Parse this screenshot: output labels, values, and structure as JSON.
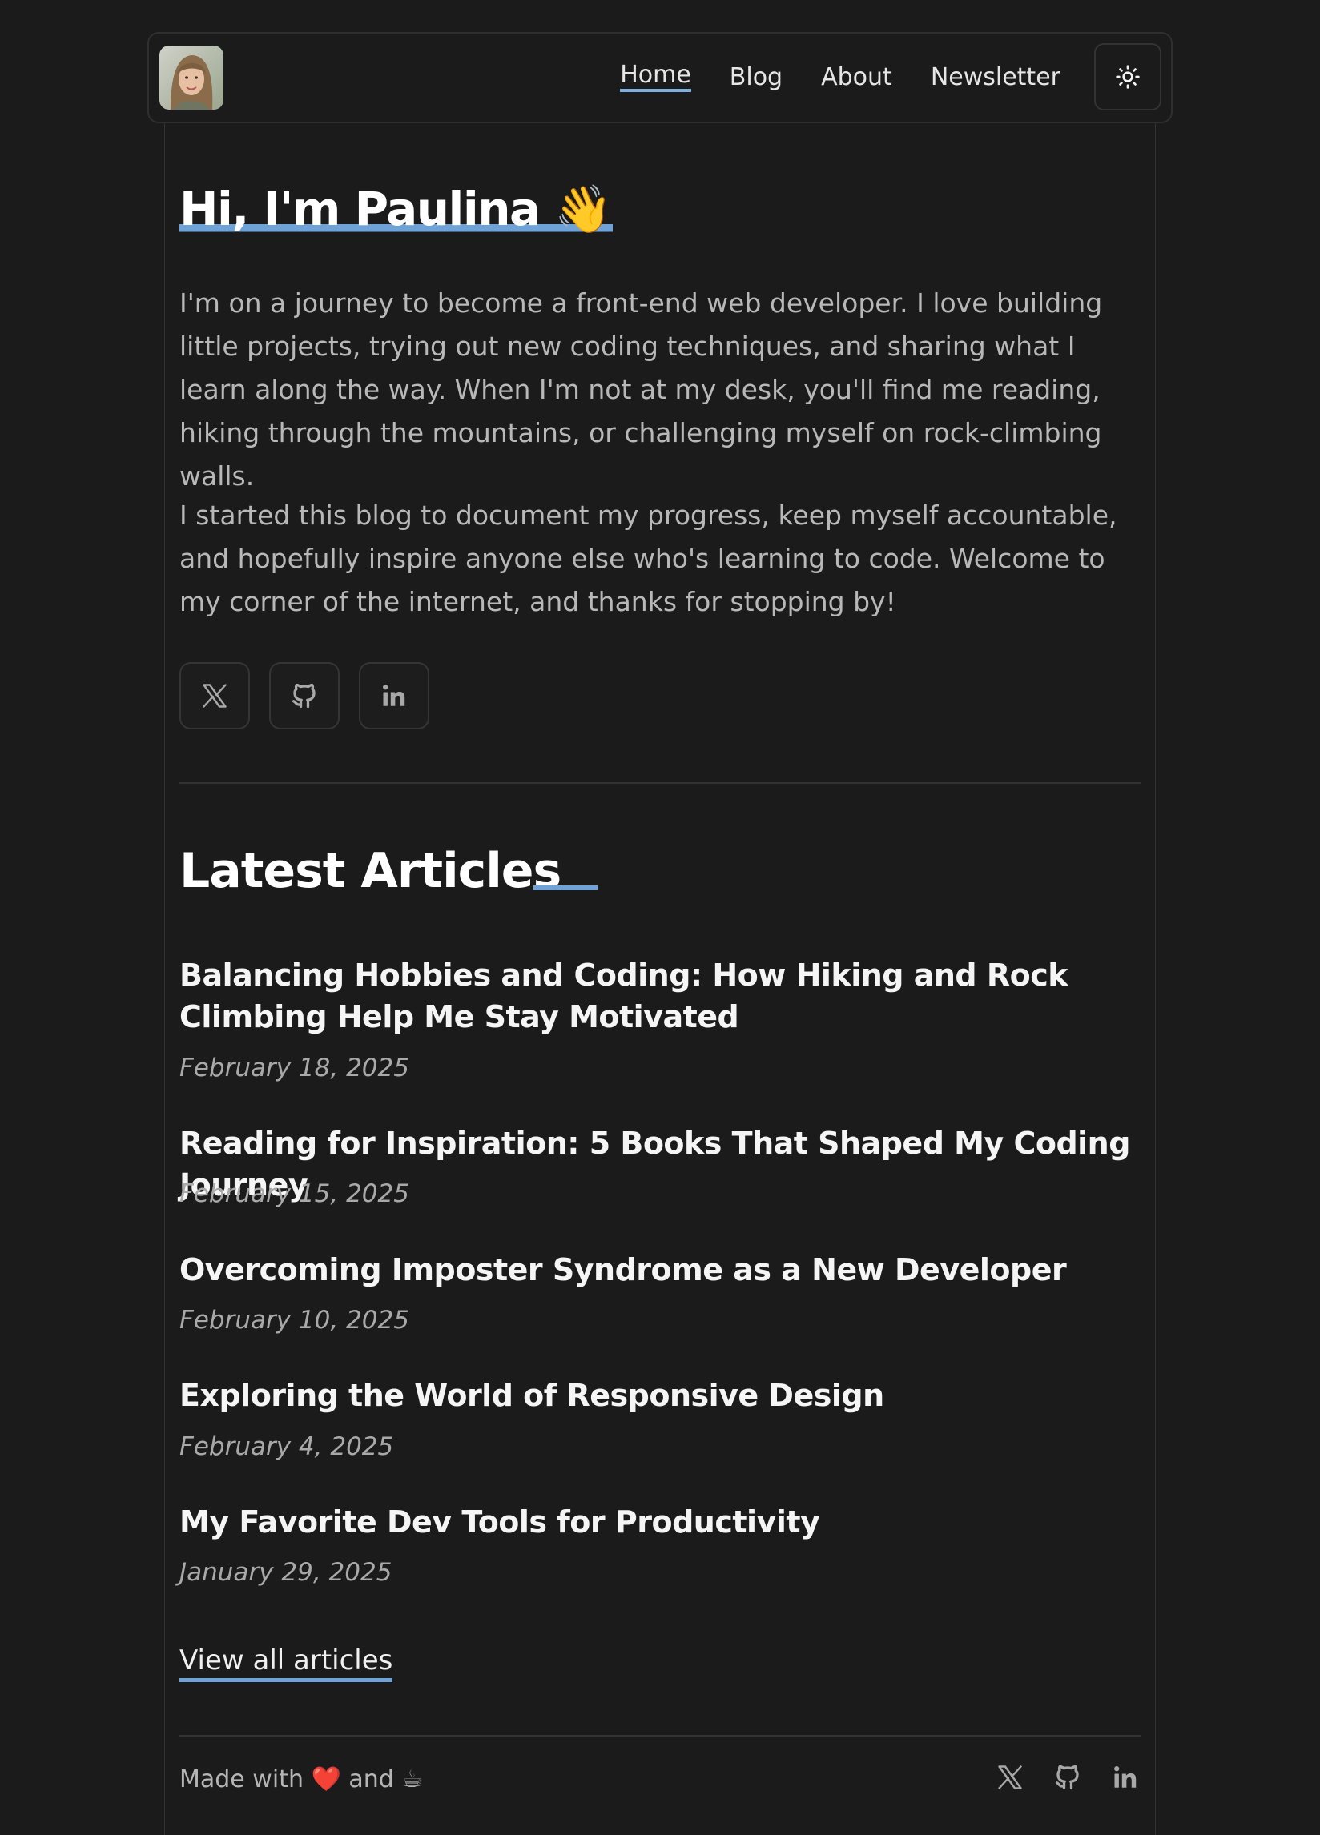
{
  "nav": {
    "links": [
      {
        "label": "Home",
        "active": true
      },
      {
        "label": "Blog",
        "active": false
      },
      {
        "label": "About",
        "active": false
      },
      {
        "label": "Newsletter",
        "active": false
      }
    ],
    "theme_icon": "sun-icon"
  },
  "hero": {
    "title": "Hi, I'm Paulina",
    "emoji": "👋",
    "paragraphs": [
      "I'm on a journey to become a front-end web developer. I love building little projects, trying out new coding techniques, and sharing what I learn along the way. When I'm not at my desk, you'll find me reading, hiking through the mountains, or challenging myself on rock-climbing walls.",
      "I started this blog to document my progress, keep myself accountable, and hopefully inspire anyone else who's learning to code. Welcome to my corner of the internet, and thanks for stopping by!"
    ],
    "socials": [
      "x-icon",
      "github-icon",
      "linkedin-icon"
    ]
  },
  "articles": {
    "heading": "Latest Articles",
    "items": [
      {
        "title": "Balancing Hobbies and Coding: How Hiking and Rock Climbing Help Me Stay Motivated",
        "date": "February 18, 2025"
      },
      {
        "title": "Reading for Inspiration: 5 Books That Shaped My Coding Journey",
        "date": "February 15, 2025"
      },
      {
        "title": "Overcoming Imposter Syndrome as a New Developer",
        "date": "February 10, 2025"
      },
      {
        "title": "Exploring the World of Responsive Design",
        "date": "February 4, 2025"
      },
      {
        "title": "My Favorite Dev Tools for Productivity",
        "date": "January 29, 2025"
      }
    ],
    "view_all": "View all articles"
  },
  "footer": {
    "made_with": "Made with",
    "heart": "❤️",
    "and": "and",
    "coffee": "☕"
  },
  "colors": {
    "background": "#1c1b1b",
    "accent": "#6fa3d8"
  }
}
